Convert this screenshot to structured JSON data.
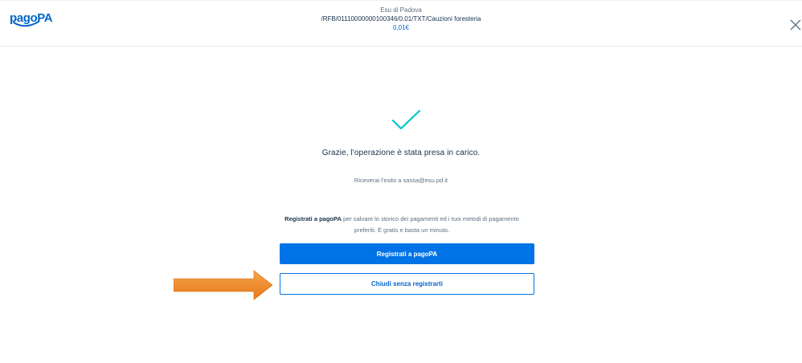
{
  "header": {
    "logo_text": "pagoPA",
    "recipient": "Esu di Padova",
    "reference": "/RFB/01110000000100346/0.01/TXT/Cauzioni foresteria",
    "amount": "0,01€"
  },
  "result": {
    "title": "Grazie, l'operazione è stata presa in carico.",
    "notice": "Riceverai l'esito a sassa@esu.pd.it"
  },
  "promo": {
    "bold": "Registrati a pagoPA",
    "text": " per salvare lo storico dei pagamenti ed i tuoi metodi di pagamento preferiti. È gratis e basta un minuto."
  },
  "actions": {
    "register_label": "Registrati a pagoPA",
    "close_label": "Chiudi senza registrarti"
  },
  "colors": {
    "brand": "#0073e6",
    "check": "#00c5ca",
    "arrow": "#f08a24"
  },
  "icons": {
    "close": "close-icon",
    "success": "checkmark-icon",
    "annotation": "arrow-right-icon"
  }
}
